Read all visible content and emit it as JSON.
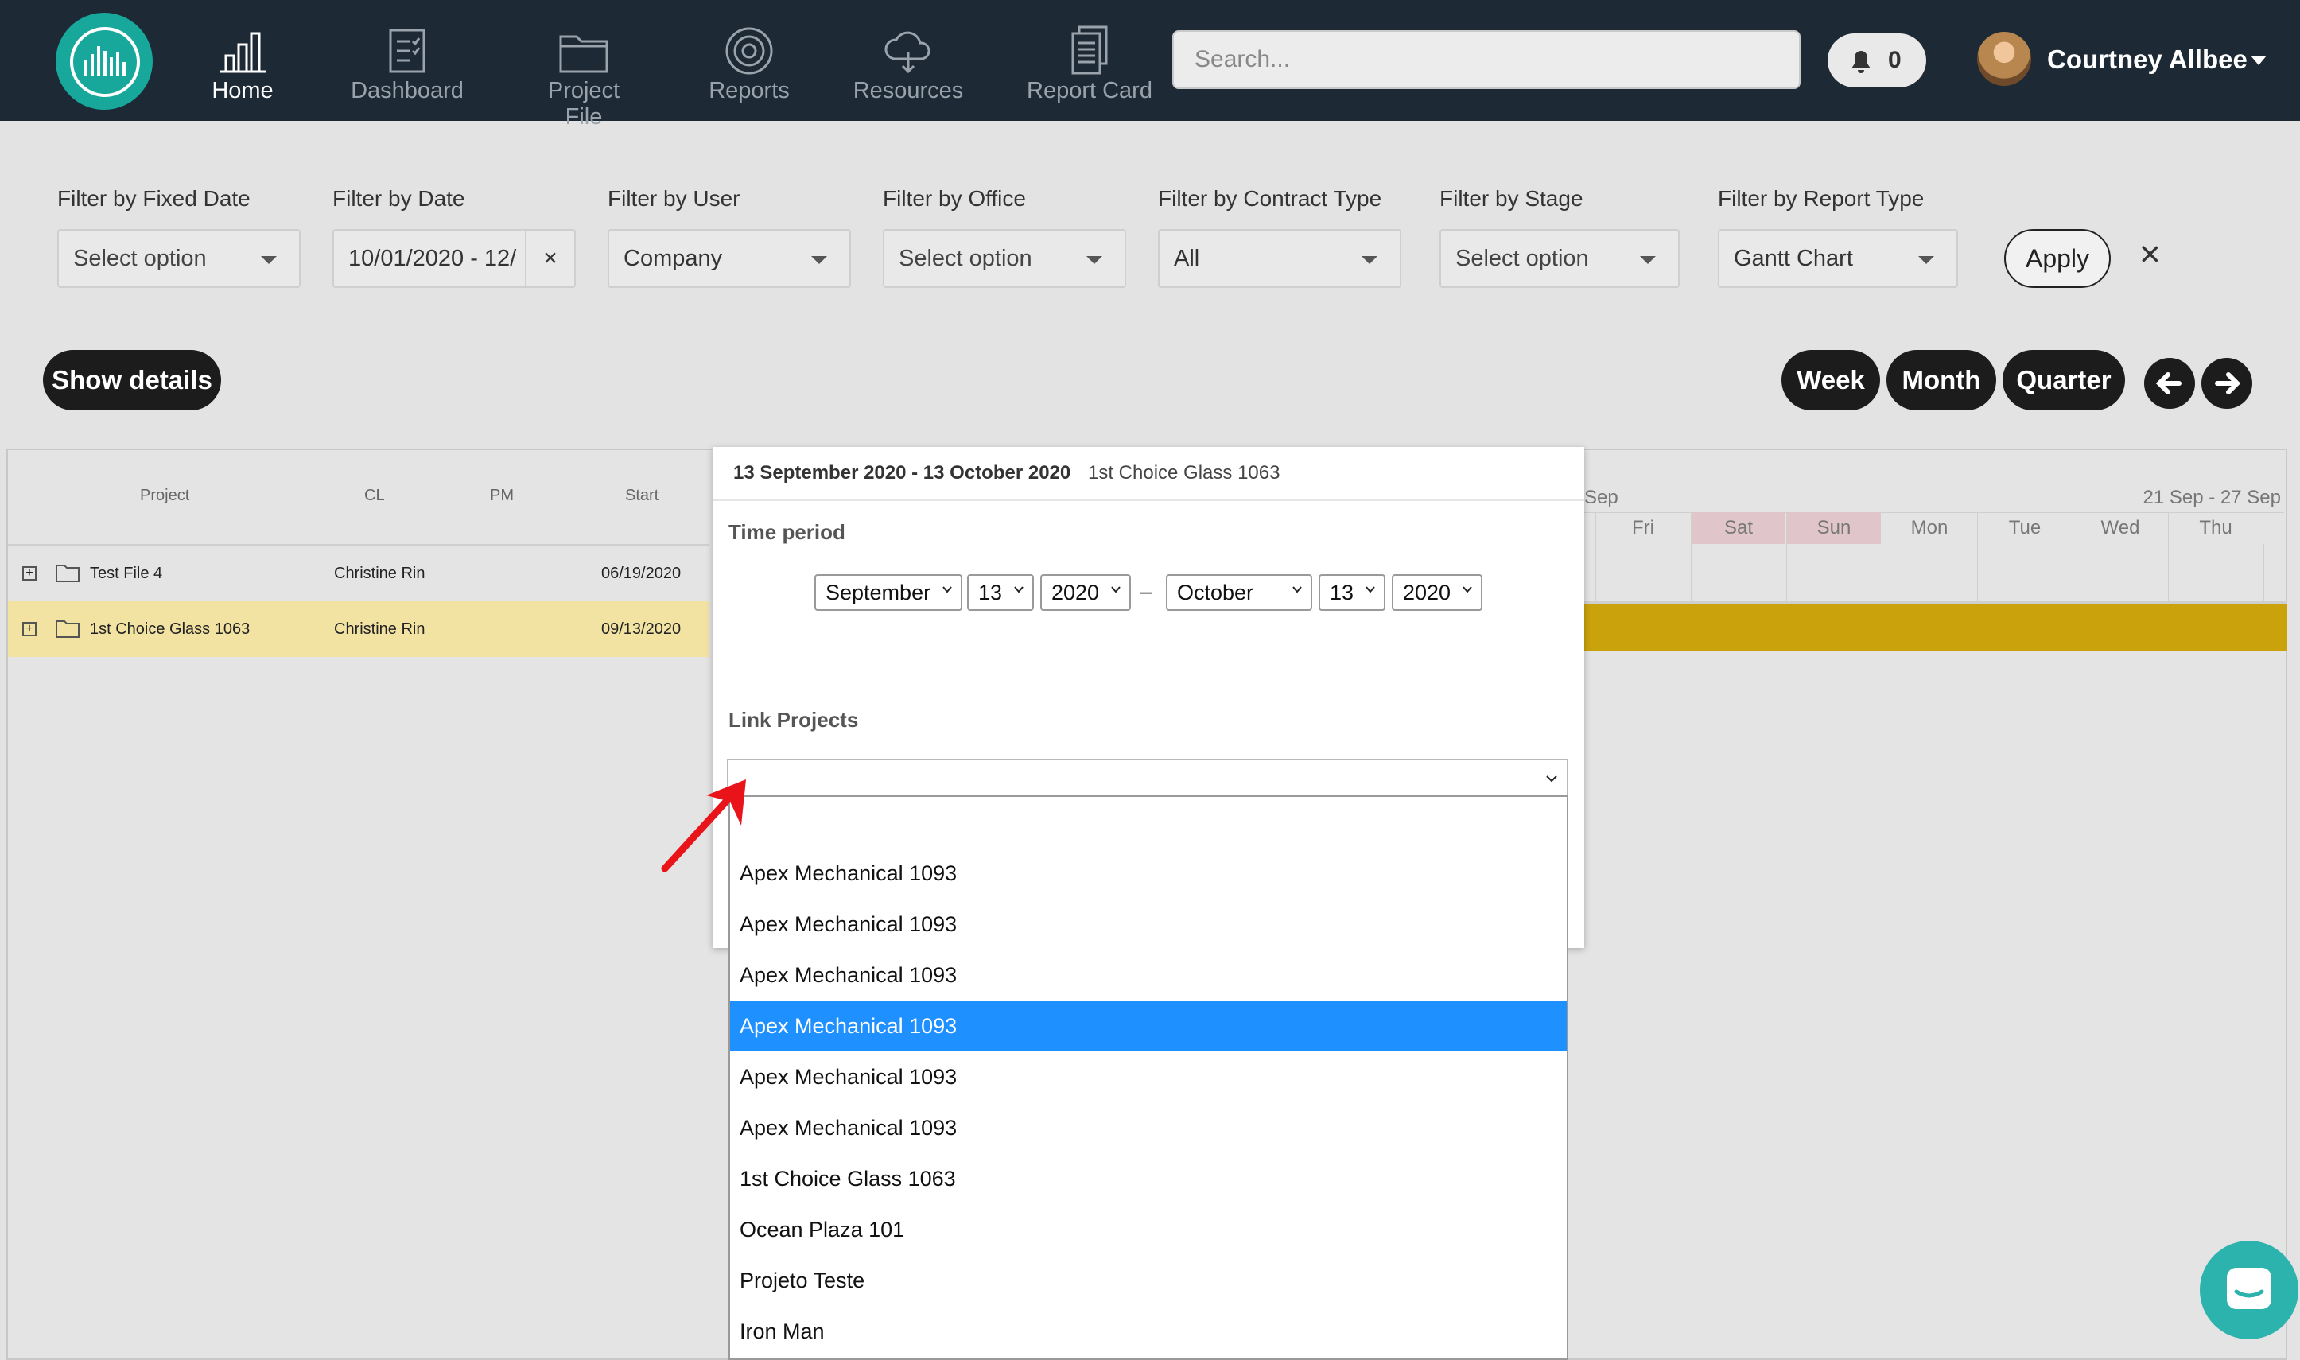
{
  "nav": {
    "items": [
      {
        "label": "Home",
        "icon": "bar-chart-icon",
        "active": true
      },
      {
        "label": "Dashboard",
        "icon": "checklist-icon"
      },
      {
        "label": "Project File",
        "icon": "folder-icon"
      },
      {
        "label": "Reports",
        "icon": "target-icon"
      },
      {
        "label": "Resources",
        "icon": "cloud-icon"
      },
      {
        "label": "Report Card",
        "icon": "document-icon"
      }
    ],
    "search_placeholder": "Search...",
    "notifications_count": "0",
    "user_name": "Courtney Allbee"
  },
  "filters": {
    "fixed_date": {
      "label": "Filter by Fixed Date",
      "value": "Select option"
    },
    "date": {
      "label": "Filter by Date",
      "value": "10/01/2020 - 12/",
      "clear": "×"
    },
    "user": {
      "label": "Filter by User",
      "value": "Company"
    },
    "office": {
      "label": "Filter by Office",
      "value": "Select option"
    },
    "contract": {
      "label": "Filter by Contract Type",
      "value": "All"
    },
    "stage": {
      "label": "Filter by Stage",
      "value": "Select option"
    },
    "report": {
      "label": "Filter by Report Type",
      "value": "Gantt Chart"
    },
    "apply": "Apply",
    "close": "×"
  },
  "toolbar": {
    "show_details": "Show details",
    "week": "Week",
    "month": "Month",
    "quarter": "Quarter"
  },
  "gantt": {
    "columns": {
      "project": "Project",
      "cl": "CL",
      "pm": "PM",
      "start": "Start"
    },
    "rows": [
      {
        "project": "Test File 4",
        "cl": "Christine Rin",
        "start": "06/19/2020"
      },
      {
        "project": "1st Choice Glass 1063",
        "cl": "Christine Rin",
        "start": "09/13/2020",
        "highlight": "#f2e3a3"
      }
    ],
    "timeline": {
      "week_left": "Sep",
      "week_right": "21 Sep - 27 Sep",
      "days": [
        "Fri",
        "Sat",
        "Sun",
        "Mon",
        "Tue",
        "Wed",
        "Thu"
      ],
      "bar_color": "#c9a20c",
      "weekend_color": "#e0c6ca"
    }
  },
  "modal": {
    "header_range": "13 September 2020 - 13 October 2020",
    "header_project": "1st Choice Glass 1063",
    "time_period_label": "Time period",
    "from": {
      "month": "September",
      "day": "13",
      "year": "2020"
    },
    "dash": "–",
    "to": {
      "month": "October",
      "day": "13",
      "year": "2020"
    },
    "link_projects_label": "Link Projects",
    "options": [
      "Apex Mechanical 1093",
      "Apex Mechanical 1093",
      "Apex Mechanical 1093",
      "Apex Mechanical 1093",
      "Apex Mechanical 1093",
      "Apex Mechanical 1093",
      "1st Choice Glass 1063",
      "Ocean Plaza 101",
      "Projeto Teste",
      "Iron Man"
    ],
    "selected_option_index": 3
  },
  "colors": {
    "topbar": "#1d2a35",
    "brand": "#17a79b",
    "selected": "#1e90ff",
    "annotation_arrow": "#e8141a"
  }
}
